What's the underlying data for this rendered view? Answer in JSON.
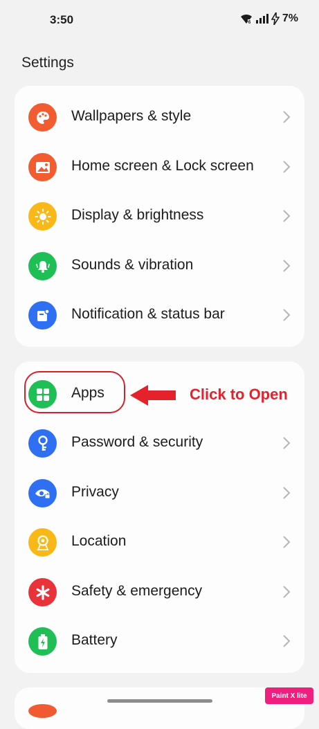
{
  "status_bar": {
    "time": "3:50",
    "battery": "7%",
    "icons": [
      "wifi-icon",
      "signal-icon",
      "charging-icon"
    ]
  },
  "page_title": "Settings",
  "groups": [
    {
      "items": [
        {
          "label": "Wallpapers & style",
          "icon": "palette-icon",
          "color": "#f15c30"
        },
        {
          "label": "Home screen & Lock screen",
          "icon": "image-icon",
          "color": "#f15c30"
        },
        {
          "label": "Display & brightness",
          "icon": "sun-icon",
          "color": "#f8b818"
        },
        {
          "label": "Sounds & vibration",
          "icon": "bell-icon",
          "color": "#20bf55"
        },
        {
          "label": "Notification & status bar",
          "icon": "notification-icon",
          "color": "#2f6ff2"
        }
      ]
    },
    {
      "items": [
        {
          "label": "Apps",
          "icon": "apps-grid-icon",
          "color": "#20bf55"
        },
        {
          "label": "Password & security",
          "icon": "key-icon",
          "color": "#2f6ff2"
        },
        {
          "label": "Privacy",
          "icon": "eye-lock-icon",
          "color": "#2f6ff2"
        },
        {
          "label": "Location",
          "icon": "location-pin-icon",
          "color": "#f8b818"
        },
        {
          "label": "Safety & emergency",
          "icon": "asterisk-icon",
          "color": "#e8333b"
        },
        {
          "label": "Battery",
          "icon": "battery-icon",
          "color": "#20bf55"
        }
      ]
    }
  ],
  "annotation": {
    "text": "Click to Open",
    "color": "#e5212b"
  },
  "watermark": "Paint X lite"
}
